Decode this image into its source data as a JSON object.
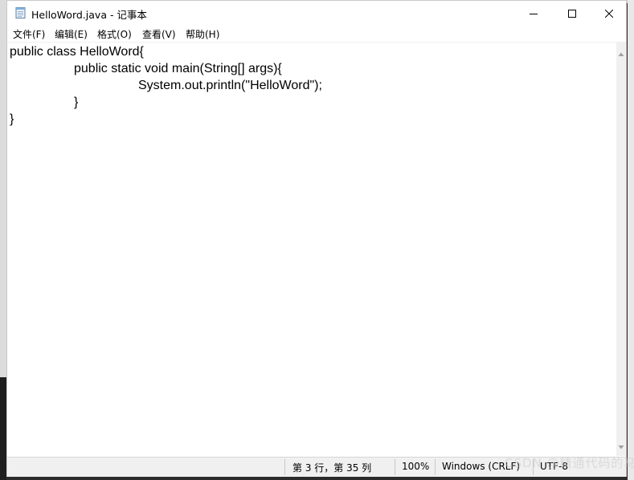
{
  "window": {
    "title": "HelloWord.java - 记事本",
    "icon": "notepad-icon",
    "controls": [
      "minimize-icon",
      "maximize-icon",
      "close-icon"
    ]
  },
  "menu": {
    "items": [
      {
        "label": "文件(F)"
      },
      {
        "label": "编辑(E)"
      },
      {
        "label": "格式(O)"
      },
      {
        "label": "查看(V)"
      },
      {
        "label": "帮助(H)"
      }
    ]
  },
  "editor": {
    "lines": [
      "public class HelloWord{",
      "public static void main(String[] args){",
      "System.out.println(\"HelloWord\");",
      "}",
      "}"
    ]
  },
  "status": {
    "position": "第 3 行，第 35 列",
    "zoom": "100%",
    "line_ending": "Windows (CRLF)",
    "encoding": "UTF-8"
  },
  "watermark": "CSDN @精通代码的马克"
}
